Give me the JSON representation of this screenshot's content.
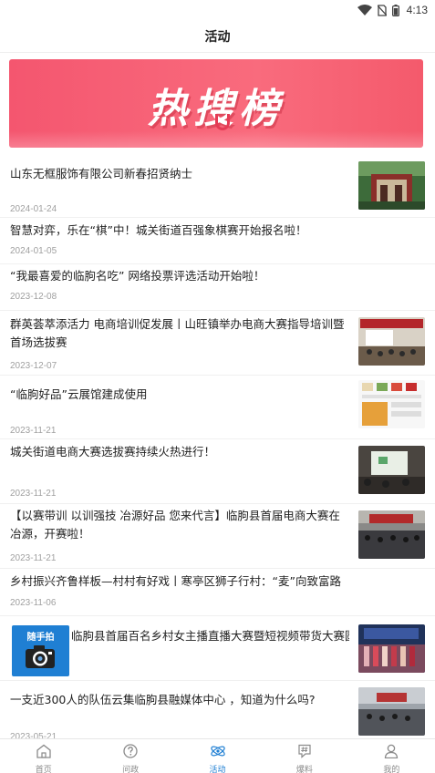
{
  "status_bar": {
    "time": "4:13"
  },
  "header": {
    "title": "活动"
  },
  "banner": {
    "text": "热搜榜"
  },
  "news": [
    {
      "title": "山东无框服饰有限公司新春招贤纳士",
      "date": "2024-01-24",
      "has_thumb": true
    },
    {
      "title": "智慧对弈，乐在“棋”中！城关街道百强象棋赛开始报名啦！",
      "date": "2024-01-05",
      "has_thumb": false
    },
    {
      "title": "“我最喜爱的临朐名吃” 网络投票评选活动开始啦！",
      "date": "2023-12-08",
      "has_thumb": false
    },
    {
      "title": "群英荟萃添活力 电商培训促发展丨山旺镇举办电商大赛指导培训暨首场选拔赛",
      "date": "2023-12-07",
      "has_thumb": true
    },
    {
      "title": "“临朐好品”云展馆建成使用",
      "date": "2023-11-21",
      "has_thumb": true
    },
    {
      "title": "城关街道电商大赛选拔赛持续火热进行！",
      "date": "2023-11-21",
      "has_thumb": true
    },
    {
      "title": "【以赛带训 以训强技 冶源好品 您来代言】临朐县首届电商大赛在冶源，开赛啦！",
      "date": "2023-11-21",
      "has_thumb": true
    },
    {
      "title": "乡村振兴齐鲁样板—村村有好戏丨寒亭区狮子行村：“麦”向致富路",
      "date": "2023-11-06",
      "has_thumb": false
    },
    {
      "title": "临朐县首届百名乡村女主播直播大赛暨短视频带货大赛圆满落幕",
      "date": "",
      "has_thumb": true
    },
    {
      "title": "一支近300人的队伍云集临朐县融媒体中心 ，知道为什么吗?",
      "date": "2023-05-21",
      "has_thumb": true
    }
  ],
  "float_button": {
    "label": "随手拍"
  },
  "tabs": [
    {
      "label": "首页",
      "icon": "home-icon"
    },
    {
      "label": "问政",
      "icon": "question-icon"
    },
    {
      "label": "活动",
      "icon": "activity-icon",
      "active": true
    },
    {
      "label": "爆料",
      "icon": "report-icon"
    },
    {
      "label": "我的",
      "icon": "profile-icon"
    }
  ],
  "colors": {
    "accent": "#1f7fd3",
    "banner": "#f4566f"
  }
}
